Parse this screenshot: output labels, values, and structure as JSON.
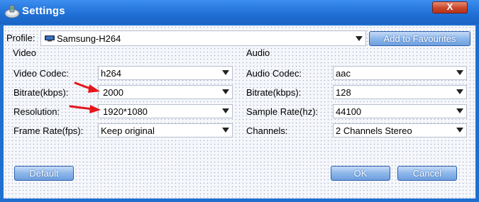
{
  "window": {
    "title": "Settings",
    "close_symbol": "X",
    "icons": {
      "app": "settings-app-icon",
      "close": "close-icon",
      "dropdown": "chevron-down-icon",
      "annotation": "red-arrow-icon",
      "device": "tv-icon"
    },
    "colors": {
      "titlebar": "#1f6fd5",
      "close": "#c8472c",
      "button": "#8db7ea",
      "annotation_arrow": "#e4161b"
    }
  },
  "profile": {
    "label": "Profile:",
    "value": "Samsung-H264",
    "add_button": "Add to Favourites"
  },
  "video": {
    "heading": "Video",
    "codec_label": "Video Codec:",
    "codec_value": "h264",
    "bitrate_label": "Bitrate(kbps):",
    "bitrate_value": "2000",
    "resolution_label": "Resolution:",
    "resolution_value": "1920*1080",
    "framerate_label": "Frame Rate(fps):",
    "framerate_value": "Keep original"
  },
  "audio": {
    "heading": "Audio",
    "codec_label": "Audio Codec:",
    "codec_value": "aac",
    "bitrate_label": "Bitrate(kbps):",
    "bitrate_value": "128",
    "samplerate_label": "Sample Rate(hz):",
    "samplerate_value": "44100",
    "channels_label": "Channels:",
    "channels_value": "2 Channels Stereo"
  },
  "buttons": {
    "default": "Default",
    "ok": "OK",
    "cancel": "Cancel"
  }
}
